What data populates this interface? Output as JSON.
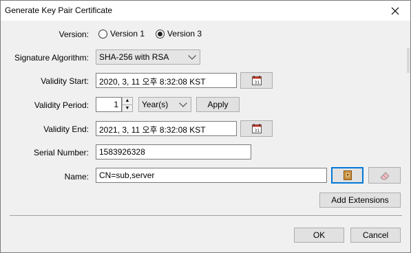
{
  "window": {
    "title": "Generate Key Pair Certificate"
  },
  "icons": {
    "close": "close-icon",
    "calendar": "calendar-icon",
    "address_book": "address-book-icon",
    "eraser": "eraser-icon"
  },
  "form": {
    "version_label": "Version:",
    "version_options": [
      "Version 1",
      "Version 3"
    ],
    "version_selected": "Version 3",
    "signature_label": "Signature Algorithm:",
    "signature_value": "SHA-256 with RSA",
    "validity_start_label": "Validity Start:",
    "validity_start_value": "2020, 3, 11 오후 8:32:08 KST",
    "validity_period_label": "Validity Period:",
    "validity_period_value": "1",
    "validity_period_unit": "Year(s)",
    "apply_label": "Apply",
    "validity_end_label": "Validity End:",
    "validity_end_value": "2021, 3, 11 오후 8:32:08 KST",
    "serial_label": "Serial Number:",
    "serial_value": "1583926328",
    "name_label": "Name:",
    "name_value": "CN=sub,server"
  },
  "buttons": {
    "add_extensions": "Add Extensions",
    "ok": "OK",
    "cancel": "Cancel"
  }
}
